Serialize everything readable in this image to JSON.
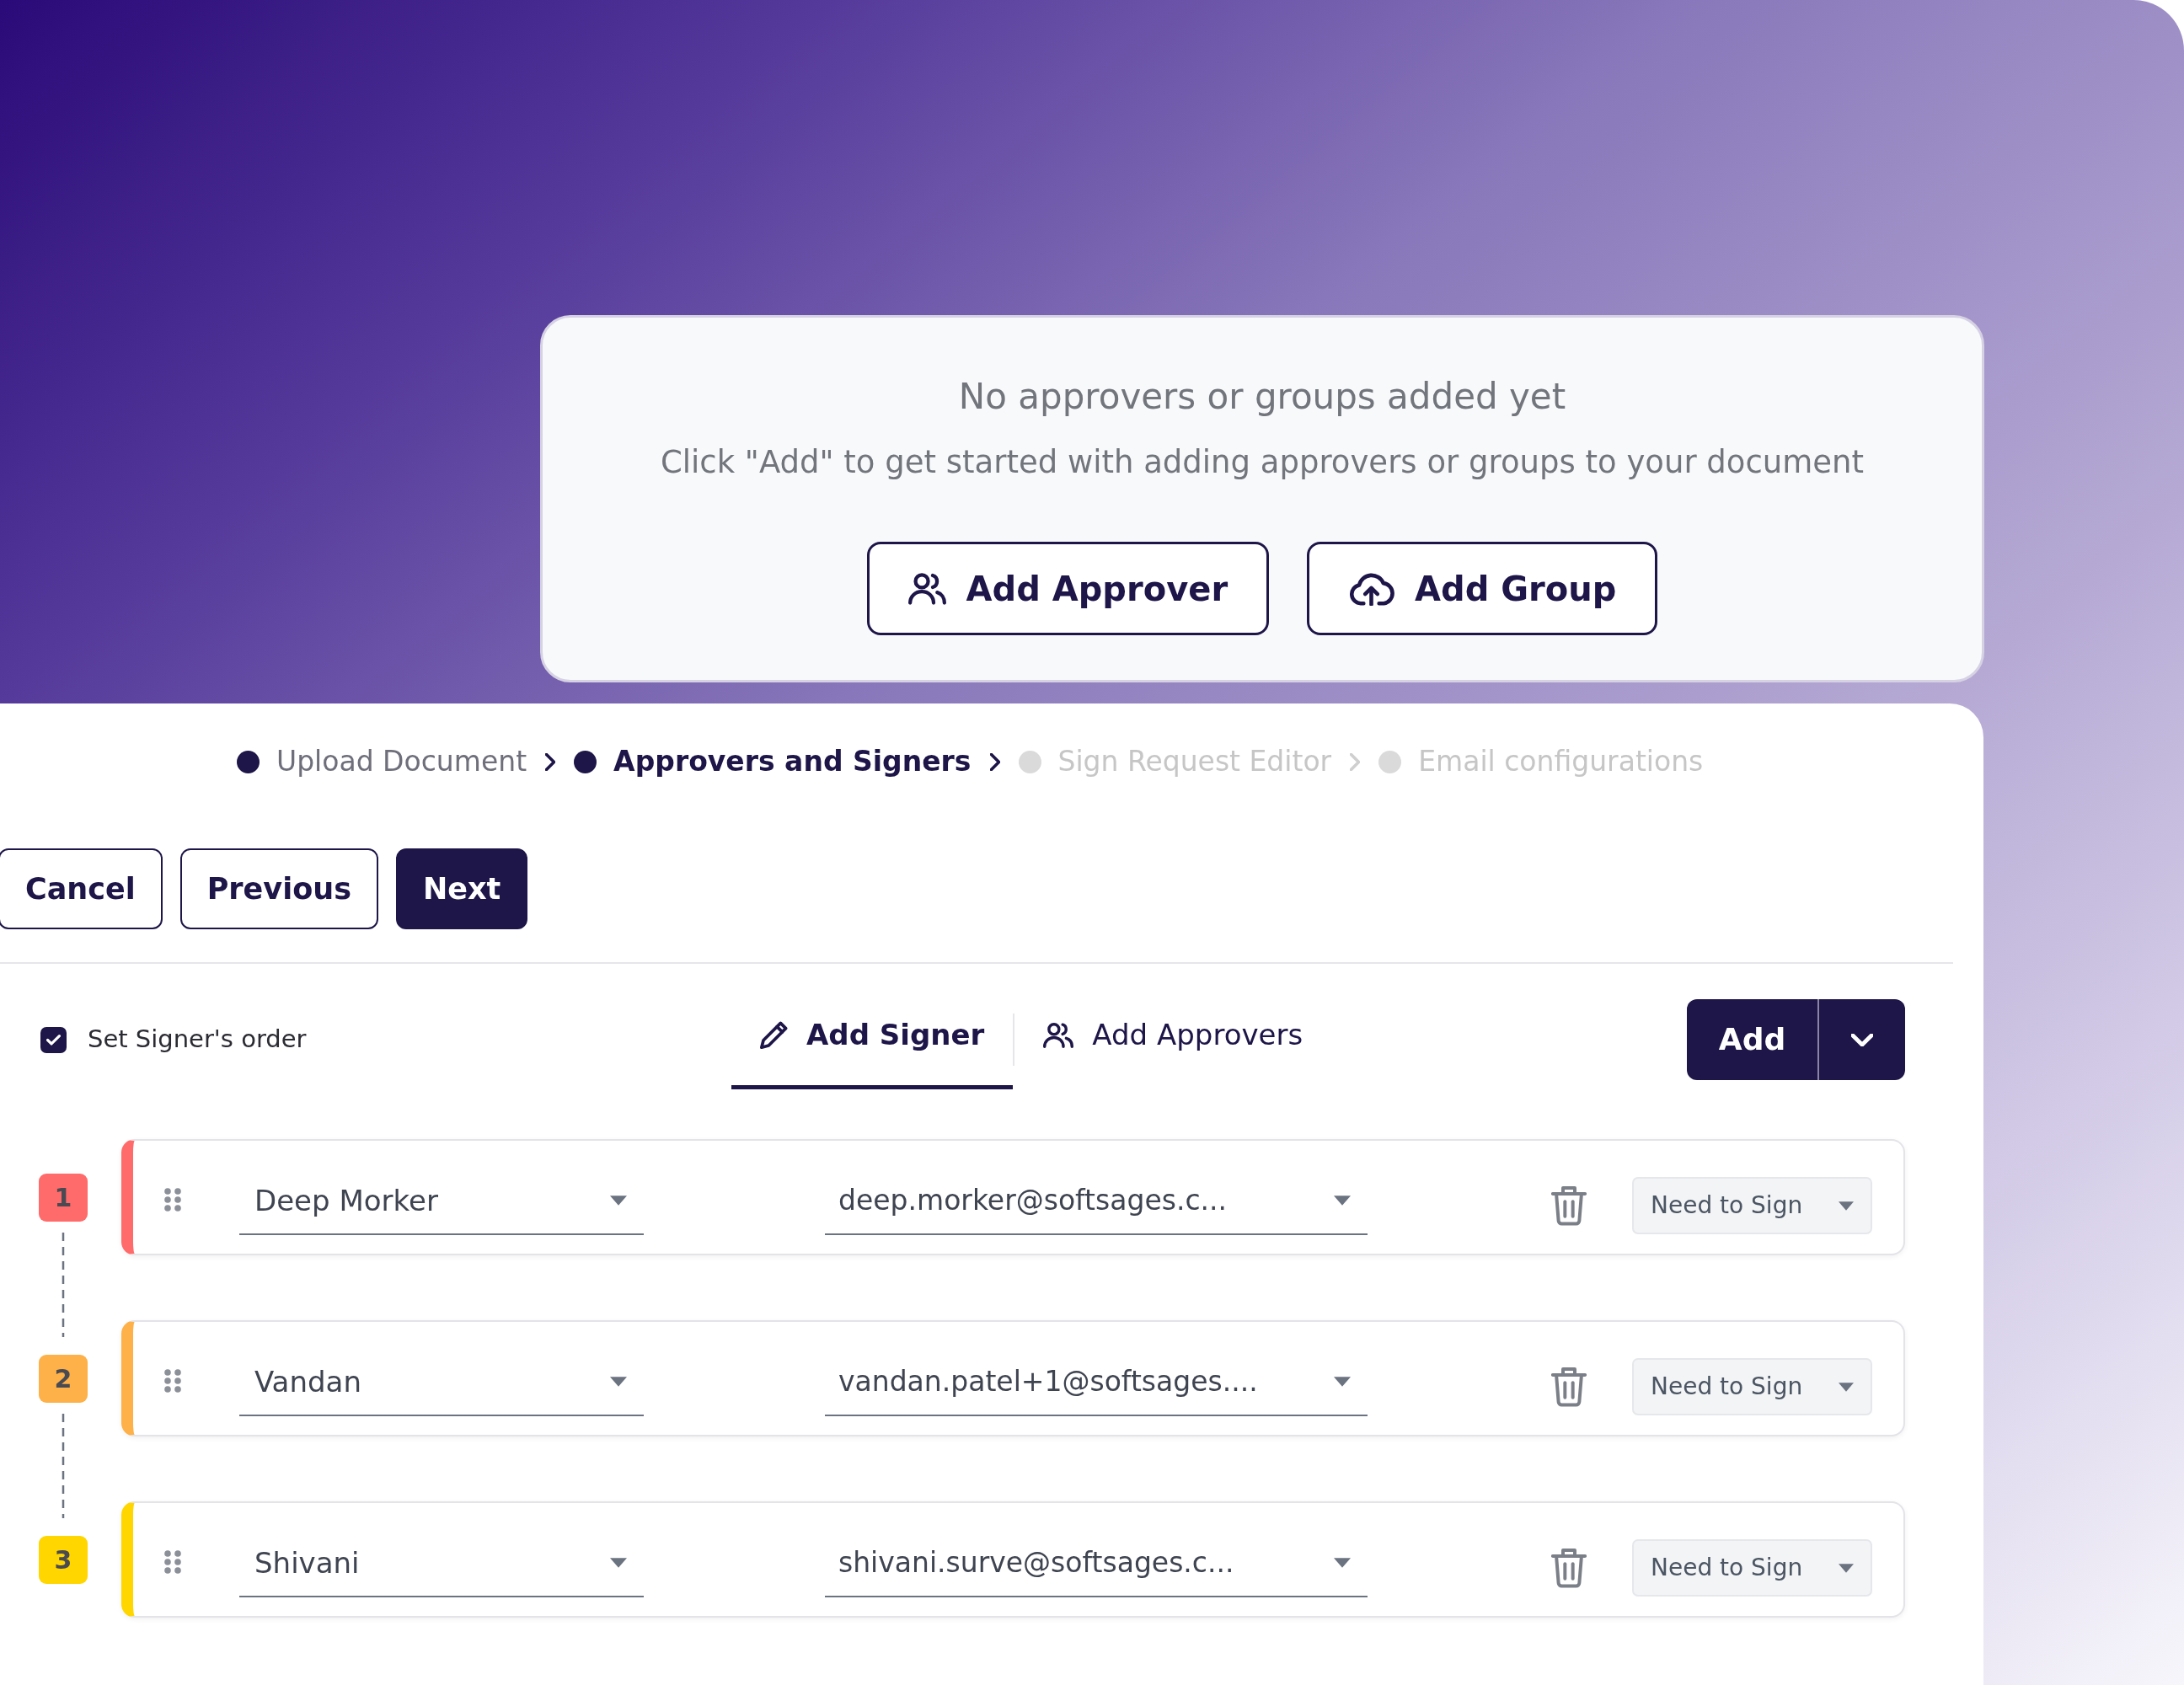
{
  "empty_state": {
    "title": "No approvers or groups added yet",
    "message": "Click \"Add\" to get started with adding approvers or groups to your document",
    "buttons": [
      {
        "label": "Add Approver",
        "kind": "person"
      },
      {
        "label": "Add Group",
        "kind": "upload"
      }
    ]
  },
  "steps": [
    {
      "label": "Upload Document",
      "reached": true,
      "selected": false
    },
    {
      "label": "Approvers and Signers",
      "reached": true,
      "selected": true
    },
    {
      "label": "Sign Request Editor",
      "reached": false,
      "selected": false
    },
    {
      "label": "Email configurations",
      "reached": false,
      "selected": false
    }
  ],
  "actions": [
    {
      "label": "Cancel",
      "kind": "outline"
    },
    {
      "label": "Previous",
      "kind": "outline"
    },
    {
      "label": "Next",
      "kind": "primary"
    }
  ],
  "signer_order": {
    "label": "Set Signer's order",
    "checked": true
  },
  "tabs": [
    {
      "label": "Add Signer",
      "kind": "pencil",
      "selected": true
    },
    {
      "label": "Add Approvers",
      "kind": "person",
      "selected": false
    }
  ],
  "add_button": {
    "label": "Add"
  },
  "signers": [
    {
      "order": "1",
      "color": "#ff6b6b",
      "name": "Deep Morker",
      "email": "deep.morker@softsages.c...",
      "role": "Need to Sign"
    },
    {
      "order": "2",
      "color": "#fdb148",
      "name": "Vandan",
      "email": "vandan.patel+1@softsages....",
      "role": "Need to Sign"
    },
    {
      "order": "3",
      "color": "#ffd600",
      "name": "Shivani",
      "email": "shivani.surve@softsages.c...",
      "role": "Need to Sign"
    }
  ]
}
